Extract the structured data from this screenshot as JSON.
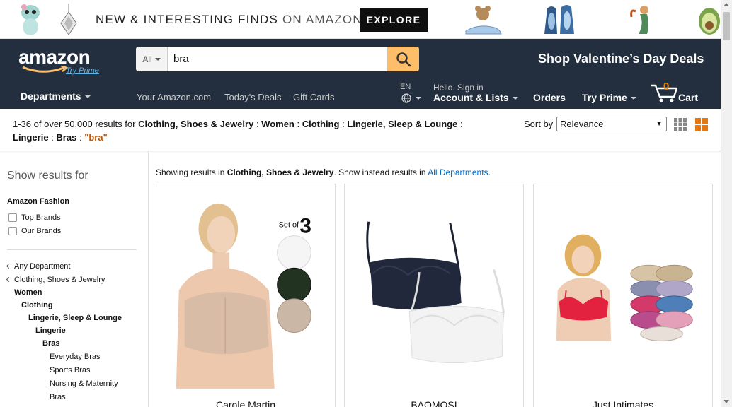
{
  "promo": {
    "headline_main": "NEW & INTERESTING FINDS",
    "headline_light": "ON AMAZON",
    "explore_label": "EXPLORE"
  },
  "header": {
    "logo_text": "amazon",
    "logo_prime": "Try Prime",
    "search_category": "All",
    "search_value": "bra",
    "promo_link": "Shop Valentine’s Day Deals",
    "departments": "Departments",
    "links": [
      "Your Amazon.com",
      "Today's Deals",
      "Gift Cards"
    ],
    "language": "EN",
    "signin_small": "Hello. Sign in",
    "account": "Account & Lists",
    "orders": "Orders",
    "try_prime": "Try Prime",
    "cart_count": "0",
    "cart_label": "Cart"
  },
  "results": {
    "count_text": "1-36 of over 50,000 results for",
    "breadcrumb": [
      "Clothing, Shoes & Jewelry",
      "Women",
      "Clothing",
      "Lingerie, Sleep & Lounge",
      "Lingerie",
      "Bras"
    ],
    "query": "\"bra\"",
    "sort_label": "Sort by",
    "sort_value": "Relevance"
  },
  "sidebar": {
    "title": "Show results for",
    "section": "Amazon Fashion",
    "checks": [
      "Top Brands",
      "Our Brands"
    ],
    "categories": [
      {
        "label": "Any Department",
        "chev": true
      },
      {
        "label": "Clothing, Shoes & Jewelry",
        "chev": true
      },
      {
        "label": "Women",
        "bold": true
      },
      {
        "label": "Clothing",
        "bold": true
      },
      {
        "label": "Lingerie, Sleep & Lounge",
        "bold": true
      },
      {
        "label": "Lingerie",
        "bold": true
      },
      {
        "label": "Bras",
        "bold": true
      },
      {
        "label": "Everyday Bras"
      },
      {
        "label": "Sports Bras"
      },
      {
        "label": "Nursing & Maternity"
      },
      {
        "label": "Bras"
      }
    ]
  },
  "main": {
    "showing_prefix": "Showing results in",
    "showing_category": "Clothing, Shoes & Jewelry",
    "showing_mid": ". Show instead results in",
    "showing_link": "All Departments",
    "products": [
      {
        "brand": "Carole Martin",
        "badge_set": "Set of",
        "badge_num": "3"
      },
      {
        "brand": "BAOMOSI"
      },
      {
        "brand": "Just Intimates"
      }
    ]
  },
  "colors": {
    "nav_bg": "#232f3e",
    "search_btn": "#febd69",
    "query": "#c45500",
    "link": "#0066c0",
    "cart_count": "#f08804"
  }
}
